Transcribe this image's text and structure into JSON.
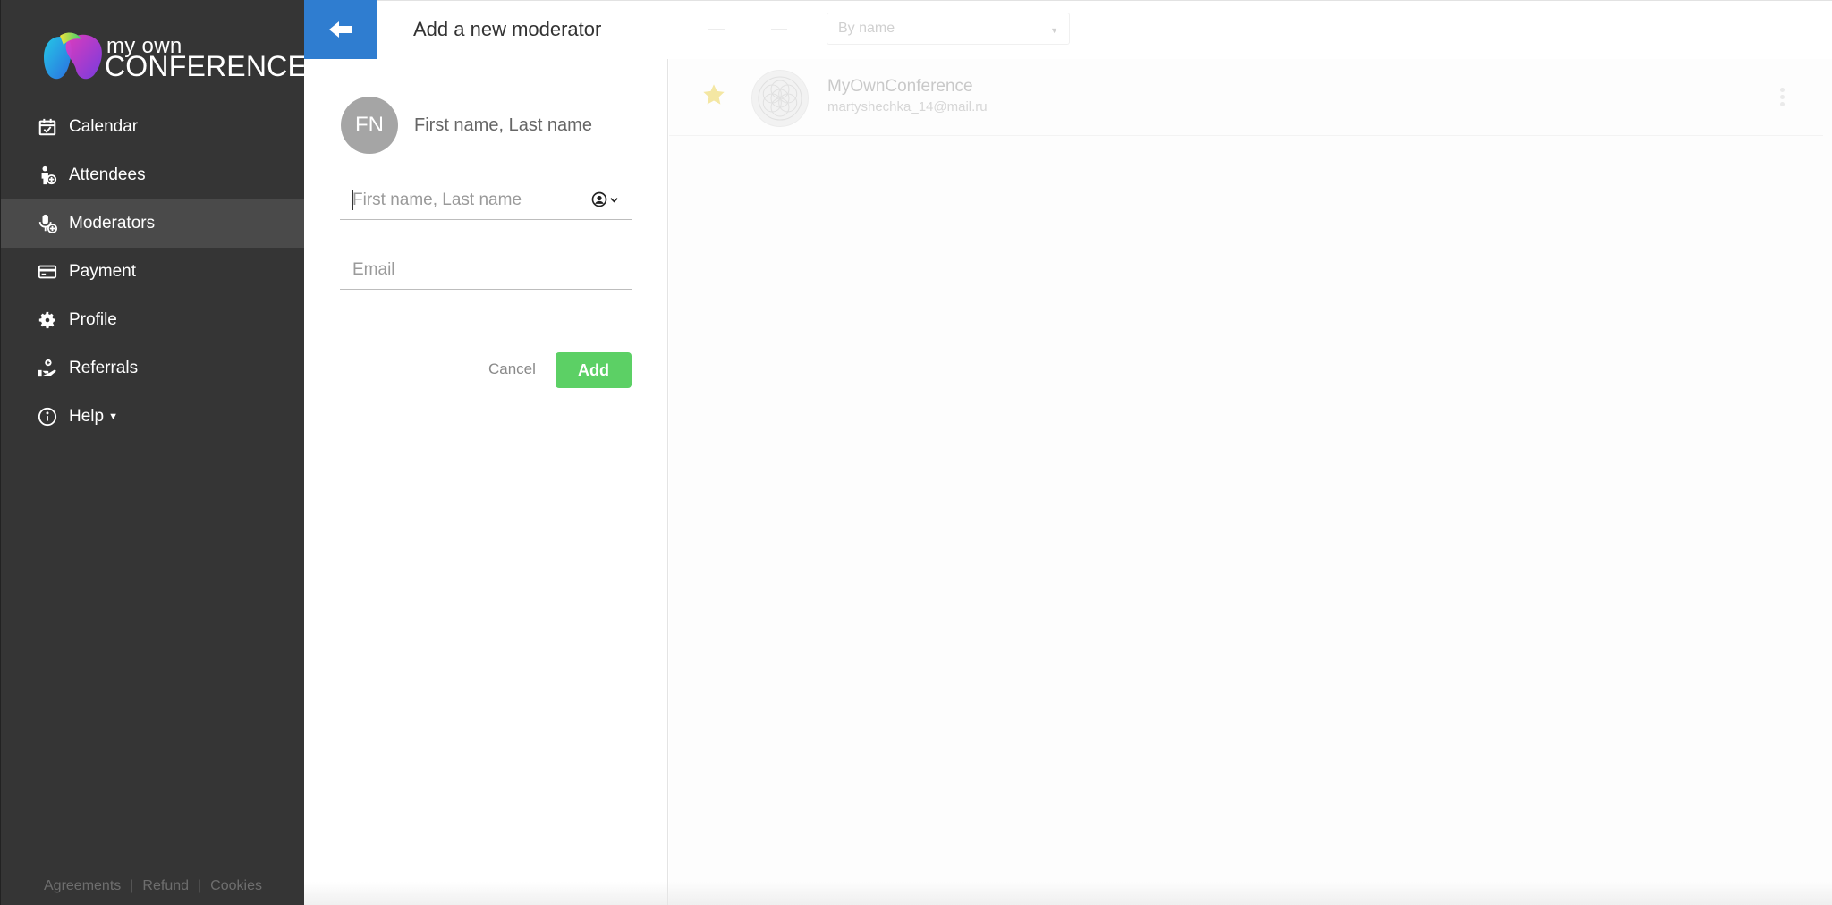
{
  "logo": {
    "line1": "my own",
    "line2": "CONFERENCE"
  },
  "sidebar": {
    "items": [
      {
        "label": "Calendar",
        "icon": "calendar-icon"
      },
      {
        "label": "Attendees",
        "icon": "attendee-icon"
      },
      {
        "label": "Moderators",
        "icon": "moderator-icon",
        "active": true
      },
      {
        "label": "Payment",
        "icon": "credit-card-icon"
      },
      {
        "label": "Profile",
        "icon": "gear-icon"
      },
      {
        "label": "Referrals",
        "icon": "referral-icon"
      },
      {
        "label": "Help",
        "icon": "info-icon",
        "has_dropdown": true
      }
    ],
    "footer": [
      "Agreements",
      "Refund",
      "Cookies"
    ]
  },
  "form": {
    "title": "Add a new moderator",
    "avatar_initials": "FN",
    "preview_name": "First name, Last name",
    "name_placeholder": "First name, Last name",
    "email_placeholder": "Email",
    "cancel_label": "Cancel",
    "add_label": "Add"
  },
  "list": {
    "sort_value": "By name",
    "rows": [
      {
        "name": "MyOwnConference",
        "email": "martyshechka_14@mail.ru",
        "starred": true
      }
    ]
  },
  "colors": {
    "sidebar_bg": "#353535",
    "sidebar_active": "#4a4a4a",
    "back_button": "#2f7dd0",
    "add_button": "#5cd065",
    "star": "#f4e7a3"
  }
}
